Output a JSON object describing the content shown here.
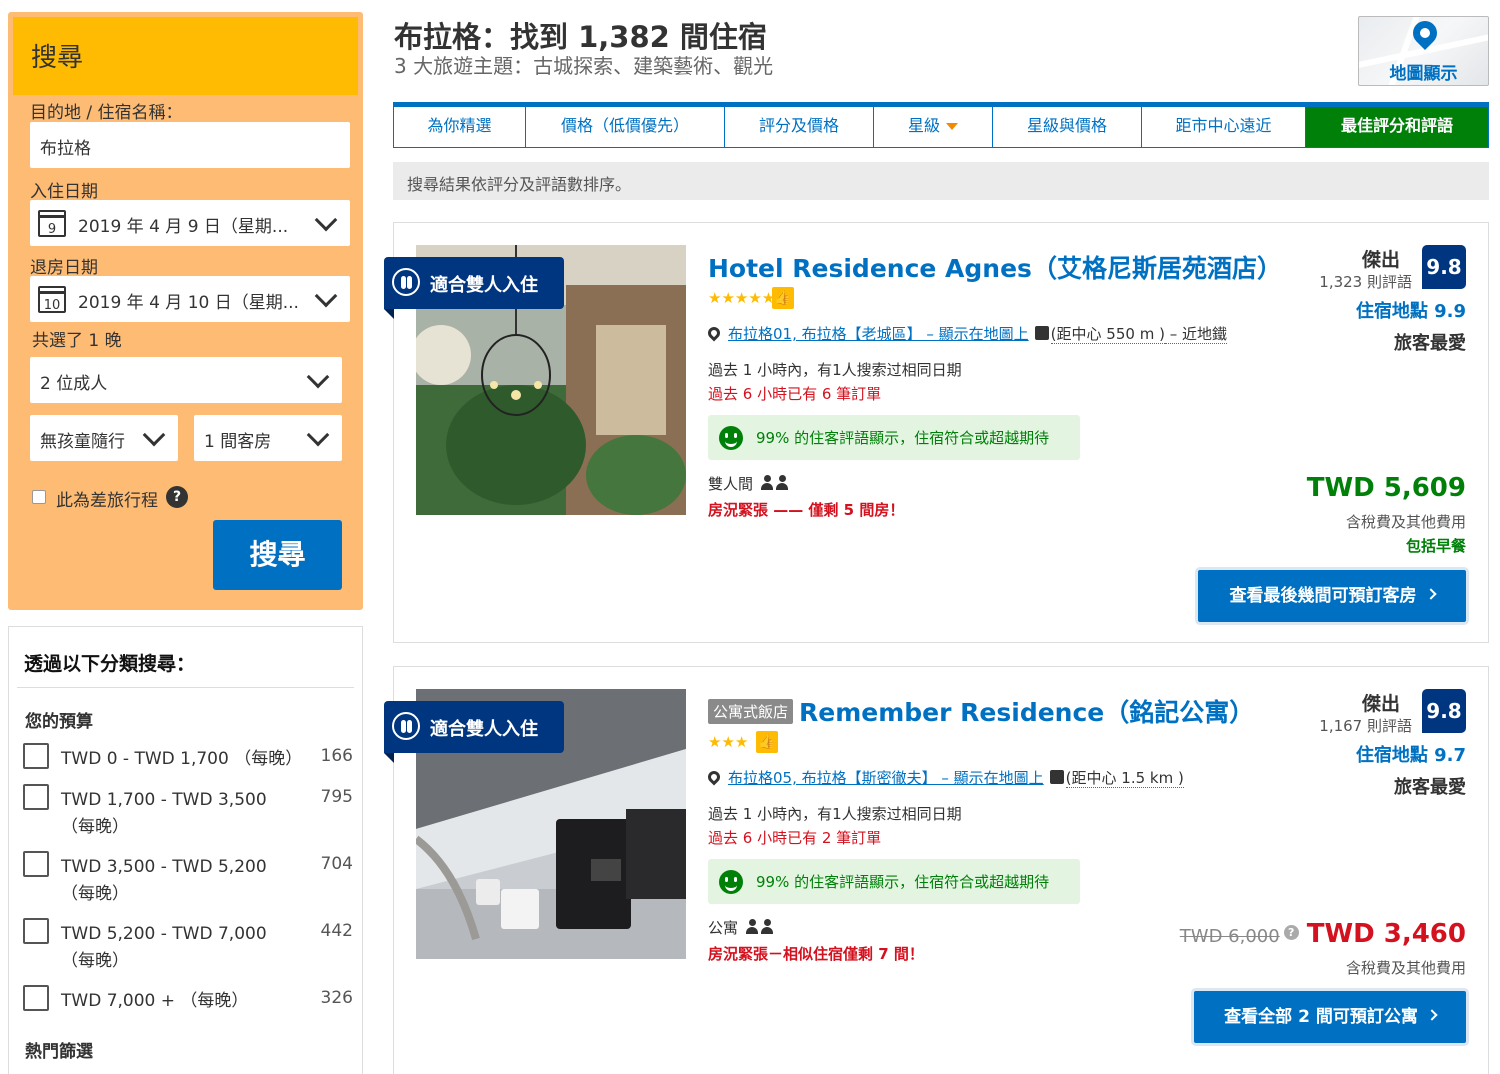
{
  "search": {
    "title": "搜尋",
    "destination_label": "目的地 / 住宿名稱：",
    "destination_value": "布拉格",
    "checkin_label": "入住日期",
    "checkin_day": "9",
    "checkin_value": "2019 年 4 月 9 日（星期...",
    "checkout_label": "退房日期",
    "checkout_day": "10",
    "checkout_value": "2019 年 4 月 10 日（星期...",
    "nights": "共選了 1 晚",
    "adults": "2 位成人",
    "children": "無孩童隨行",
    "rooms": "1 間客房",
    "business_trip": "此為差旅行程",
    "submit": "搜尋"
  },
  "filters": {
    "title": "透過以下分類搜尋：",
    "budget_heading": "您的預算",
    "budget": [
      {
        "label": "TWD 0 - TWD 1,700 （每晚）",
        "count": "166"
      },
      {
        "label": "TWD 1,700 - TWD 3,500 （每晚）",
        "count": "795"
      },
      {
        "label": "TWD 3,500 - TWD 5,200 （每晚）",
        "count": "704"
      },
      {
        "label": "TWD 5,200 - TWD 7,000 （每晚）",
        "count": "442"
      },
      {
        "label": "TWD 7,000 + （每晚）",
        "count": "326"
      }
    ],
    "popular_heading": "熱門篩選"
  },
  "header": {
    "title": "布拉格：找到 1,382 間住宿",
    "subtitle": "3 大旅遊主題：古城探索、建築藝術、觀光",
    "map_label": "地圖顯示"
  },
  "sort": {
    "tabs": [
      "為你精選",
      "價格（低價優先）",
      "評分及價格",
      "星級",
      "星級與價格",
      "距市中心遠近",
      "最佳評分和評語"
    ],
    "active_index": 6,
    "note": "搜尋結果依評分及評語數排序。"
  },
  "colors": {
    "brand": "#003580",
    "link": "#0071c2",
    "accent": "#febb02",
    "good": "#008009",
    "urgent": "#d4111e"
  },
  "hotels": [
    {
      "ribbon": "適合雙人入住",
      "badge": "",
      "name": "Hotel Residence Agnes（艾格尼斯居苑酒店）",
      "stars": "★★★★★",
      "location": "布拉格01, 布拉格【老城區】 – 顯示在地圖上",
      "distance": "(距中心 550 m )",
      "extra": " – 近地鐵",
      "viewers": "過去 1 小時內，有1人搜索过相同日期",
      "bookings": "過去 6 小時已有 6 筆訂單",
      "review_note": "99% 的住客評語顯示，住宿符合或超越期待",
      "room_type": "雙人間",
      "scarcity": "房況緊張 —— 僅剩 5 間房！",
      "score_word": "傑出",
      "review_count": "1,323 則評語",
      "score": "9.8",
      "location_score": "住宿地點 9.9",
      "favorite": "旅客最愛",
      "old_price": "",
      "price": "TWD 5,609",
      "tax": "含稅費及其他費用",
      "breakfast": "包括早餐",
      "cta": "查看最後幾間可預訂客房"
    },
    {
      "ribbon": "適合雙人入住",
      "badge": "公寓式飯店",
      "name": "Remember Residence（銘記公寓）",
      "stars": "★★★",
      "location": "布拉格05, 布拉格【斯密徹夫】 – 顯示在地圖上",
      "distance": "(距中心 1.5 km )",
      "extra": "",
      "viewers": "過去 1 小時內，有1人搜索过相同日期",
      "bookings": "過去 6 小時已有 2 筆訂單",
      "review_note": "99% 的住客評語顯示，住宿符合或超越期待",
      "room_type": "公寓",
      "scarcity": "房況緊張－相似住宿僅剩 7 間！",
      "score_word": "傑出",
      "review_count": "1,167 則評語",
      "score": "9.8",
      "location_score": "住宿地點 9.7",
      "favorite": "旅客最愛",
      "old_price": "TWD 6,000",
      "price": "TWD 3,460",
      "tax": "含稅費及其他費用",
      "breakfast": "",
      "cta": "查看全部 2 間可預訂公寓"
    }
  ]
}
